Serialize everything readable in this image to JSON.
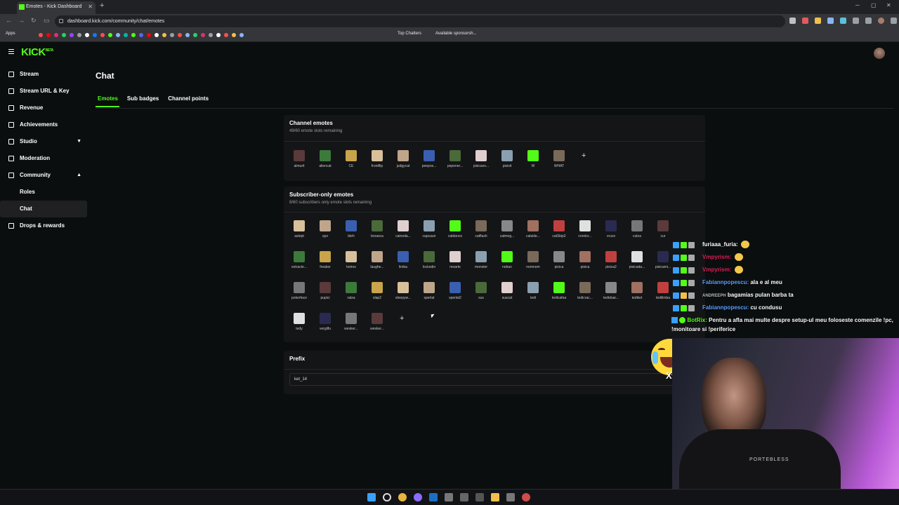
{
  "browser": {
    "tab_title": "Emotes - Kick Dashboard",
    "url": "dashboard.kick.com/community/chat/emotes",
    "bookmarks": [
      "Apps",
      "Top Chatters",
      "Available sponsorsh..."
    ]
  },
  "app": {
    "logo": "KICK",
    "logo_tag": "BETA"
  },
  "sidebar": {
    "items": [
      {
        "label": "Stream",
        "icon": "video-icon"
      },
      {
        "label": "Stream URL & Key",
        "icon": "link-icon"
      },
      {
        "label": "Revenue",
        "icon": "dollar-icon"
      },
      {
        "label": "Achievements",
        "icon": "trophy-icon"
      },
      {
        "label": "Studio",
        "icon": "studio-icon"
      },
      {
        "label": "Moderation",
        "icon": "shield-icon"
      },
      {
        "label": "Community",
        "icon": "community-icon"
      },
      {
        "label": "Drops & rewards",
        "icon": "gift-icon"
      }
    ],
    "sub_items": [
      "Roles",
      "Chat"
    ]
  },
  "page": {
    "title": "Chat",
    "tabs": [
      "Emotes",
      "Sub badges",
      "Channel points"
    ]
  },
  "channel_emotes": {
    "title": "Channel emotes",
    "subtitle": "49/60 emote slots remaining",
    "items": [
      "almurit",
      "aliencat",
      "CE",
      "frontflip",
      "judgycat",
      "peepos...",
      "pepener...",
      "pisicavo...",
      "pisisit",
      "W",
      "WHAT"
    ]
  },
  "subscriber_emotes": {
    "title": "Subscriber-only emotes",
    "subtitle": "8/60 subscribers only emote slots remaining",
    "rows": [
      [
        "astept",
        "ayo",
        "bleh",
        "broasca",
        "caineda...",
        "capcaun",
        "catdance",
        "catflash",
        "catmog...",
        "catside...",
        "catSkip2",
        "crontcr...",
        "cruce",
        "culea",
        "cur"
      ],
      [
        "estracte...",
        "freaker",
        "ketros",
        "laughe...",
        "limba",
        "lockedin",
        "moarte",
        "monster",
        "nebun",
        "nomnom",
        "picica",
        "pisica",
        "pisica2",
        "pisicada...",
        "pisicami..."
      ],
      [
        "pokerface",
        "pupici",
        "ratza",
        "slap2",
        "sleepyw...",
        "sperlat",
        "sperlat2",
        "sus",
        "suscat",
        "tedi",
        "tedicafea",
        "tedicrac...",
        "tedidoar...",
        "tediket",
        "tedilimba"
      ],
      [
        "tedy",
        "vergilfu",
        "wesker...",
        "wesker..."
      ]
    ]
  },
  "prefix": {
    "title": "Prefix",
    "value": "ket_14"
  },
  "chat_overlay": [
    {
      "user": "furiaaa_furia:",
      "msg": "",
      "color": "#ffffff"
    },
    {
      "user": "Vmpyrism:",
      "msg": "",
      "color": "#e0245e"
    },
    {
      "user": "Vmpyrism:",
      "msg": "",
      "color": "#e0245e"
    },
    {
      "user": "Fabiannpopescu:",
      "msg": "ala e al meu",
      "color": "#5aa0ff"
    },
    {
      "user": "ANDREEPH",
      "msg": "bagamias pulan barba ta",
      "color": "#cccccc"
    },
    {
      "user": "Fabiannpopescu:",
      "msg": "cu condusu",
      "color": "#5aa0ff"
    },
    {
      "user": "BotRix:",
      "msg": "Pentru a afla mai multe despre setup-ul meu foloseste comenzile !pc, !monitoare si !periferice",
      "color": "#53fc18"
    }
  ],
  "overlay_multiplier": "X8",
  "webcam": {
    "shirt_text": "PORTEBLESS"
  },
  "colors": {
    "accent": "#53fc18",
    "background": "#0b0e0f",
    "panel": "#141517"
  }
}
